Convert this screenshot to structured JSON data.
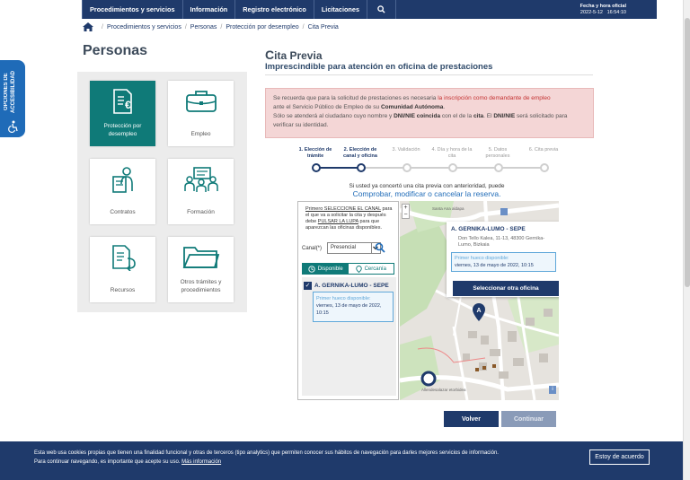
{
  "nav": {
    "items": [
      "Procedimientos y servicios",
      "Información",
      "Registro electrónico",
      "Licitaciones"
    ],
    "datetime_title": "Fecha y hora oficial",
    "date": "2022-5-12",
    "time": "16:54:10"
  },
  "breadcrumb": [
    "Procedimientos y servicios",
    "Personas",
    "Protección por desempleo",
    "Cita Previa"
  ],
  "accessibility_label": "OPCIONES DE ACCESIBILIDAD",
  "sidebar": {
    "title": "Personas",
    "tiles": [
      {
        "label": "Protección por desempleo",
        "icon": "euro-document-icon"
      },
      {
        "label": "Empleo",
        "icon": "briefcase-icon"
      },
      {
        "label": "Contratos",
        "icon": "contract-person-icon"
      },
      {
        "label": "Formación",
        "icon": "training-group-icon"
      },
      {
        "label": "Recursos",
        "icon": "document-return-icon"
      },
      {
        "label": "Otros trámites y procedimientos",
        "icon": "folder-icon"
      }
    ]
  },
  "main": {
    "title_cap": "C",
    "title_rest": "ita Previa",
    "subtitle": "Imprescindible para atención en oficina de prestaciones",
    "alert": {
      "l1a": "Se recuerda que para la solicitud de prestaciones es necesaria ",
      "l1b": "la inscripción como demandante de empleo",
      "l2a": "ante el Servicio Público de Empleo de su ",
      "l2b": "Comunidad Autónoma",
      "l2c": ".",
      "l3a": "Sólo se atenderá al ciudadano cuyo nombre y ",
      "l3b": "DNI/NIE coincida",
      "l3c": " con el de la ",
      "l3d": "cita",
      "l3e": ". El ",
      "l3f": "DNI/NIE",
      "l3g": " será solicitado para",
      "l4": "verificar su identidad."
    },
    "steps": [
      {
        "label": "1. Elección de trámite",
        "state": "done"
      },
      {
        "label": "2. Elección de canal y oficina",
        "state": "current"
      },
      {
        "label": "3. Validación",
        "state": "todo"
      },
      {
        "label": "4. Día y hora de la cita",
        "state": "todo"
      },
      {
        "label": "5. Datos personales",
        "state": "todo"
      },
      {
        "label": "6. Cita previa",
        "state": "todo"
      }
    ],
    "previous_text": "Si usted ya concertó una cita previa con anterioridad, puede",
    "previous_link": "Comprobar, modificar o cancelar la reserva."
  },
  "finder": {
    "intro_a": "Primero SELECCIONE EL CANAL",
    "intro_b": " para el que va a solicitar la cita y después ",
    "intro_c": "debe",
    "intro_d": " ",
    "intro_e": "PULSAR LA LUPA",
    "intro_f": " para que aparezcan las oficinas disponibles.",
    "canal_label": "Canal(*)",
    "canal_value": "Presencial",
    "tab_available": "Disponible",
    "tab_nearby": "Cercanía",
    "result_name": "A. GERNIKA-LUMO - SEPE",
    "first_slot_label": "Primer hueco disponible:",
    "first_slot_value": "viernes, 13 de mayo de 2022, 10:15"
  },
  "map": {
    "popup_title": "A. GERNIKA-LUMO - SEPE",
    "popup_address": "Don Tello Kalea, 11-13, 48300 Gernika-Lumo, Bizkaia",
    "popup_slot_label": "Primer hueco disponible:",
    "popup_slot_value": "viernes, 13 de mayo de 2022, 10:15",
    "popup_button": "Seleccionar otra oficina",
    "marker_letter": "A",
    "street_1": "Santa Ana aldapa",
    "street_2": "Allendesalazar etorbidea",
    "zoom_plus": "+",
    "zoom_minus": "−",
    "info_label": "i"
  },
  "buttons": {
    "back": "Volver",
    "continue": "Continuar"
  },
  "cookie": {
    "line1": "Esta web usa cookies propias que tienen una finalidad funcional y otras de terceros (tipo analytics) que permiten conocer sus hábitos de navegación para darles mejores servicios de información.",
    "line2": "Para continuar navegando, es importante que acepte su uso. ",
    "more_link": "Más información",
    "agree": "Estoy de acuerdo"
  },
  "colors": {
    "navy": "#1f3a6b",
    "teal": "#0f7a78",
    "alert_bg": "#f4d6d6",
    "link_blue": "#1f6bb8"
  }
}
